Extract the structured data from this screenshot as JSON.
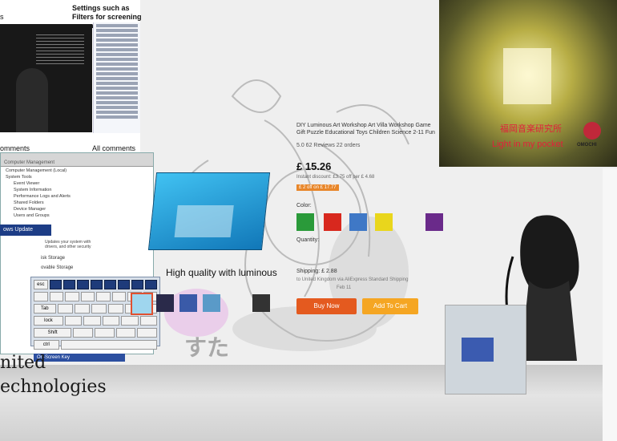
{
  "annotations": {
    "settings_note": "Settings such as Filters for screening comments",
    "comments_label": "omments",
    "all_comments_label": "All comments",
    "s_label": "s"
  },
  "explorer": {
    "title": "Computer Management",
    "tree": [
      "Computer Management (Local)",
      "System Tools",
      "Event Viewer",
      "System Information",
      "Performance Logs and Alerts",
      "Shared Folders",
      "Device Manager",
      "Users and Groups"
    ],
    "update_button": "ows Update",
    "update_notice": "Updates your system with drivers, and other security",
    "disk_storage": "isk Storage",
    "removable": "ovable Storage"
  },
  "keyboard": {
    "title": "On-Screen Key",
    "keys_esc": "esc",
    "keys_f": [
      "F1",
      "F2",
      "F3",
      "F4",
      "F5",
      "F6",
      "F7",
      "F8"
    ],
    "keys_tab": "Tab",
    "keys_shift": "Shift",
    "keys_lock": "lock",
    "keys_ctrl": "ctrl"
  },
  "product": {
    "title": "DIY Luminous Art Workshop Art Villa Workshop Game Gift Puzzle Educational Toys Children Science 2-11 Fun",
    "reviews": "5.0  62 Reviews  22 orders",
    "price": "£ 15.26",
    "discount_note": "Instant discount: £3.75 off per £ 4.68",
    "coupon": "£ 2 off on £ 17.77",
    "color_label": "Color:",
    "quantity_label": "Quantity:",
    "shipping": "Shipping: £ 2.88",
    "shipping_detail": "to United Kingdom via AliExpress Standard Shipping",
    "delivery": "Feb 11",
    "buy_now": "Buy Now",
    "add_to_cart": "Add To Cart",
    "swatches": [
      "#2a9a3a",
      "#d8281e",
      "#3f78c6",
      "#e9d61c",
      "#6a2a8a"
    ]
  },
  "tunnel": {
    "jp_text": "福岡音楽研究所",
    "en_text": "Light in my pocket",
    "logo": "OMOCHI"
  },
  "overlay": {
    "luminous_caption": "High quality with luminous",
    "jp_large": "すた",
    "united": "nited",
    "technologies": "echnologies"
  }
}
